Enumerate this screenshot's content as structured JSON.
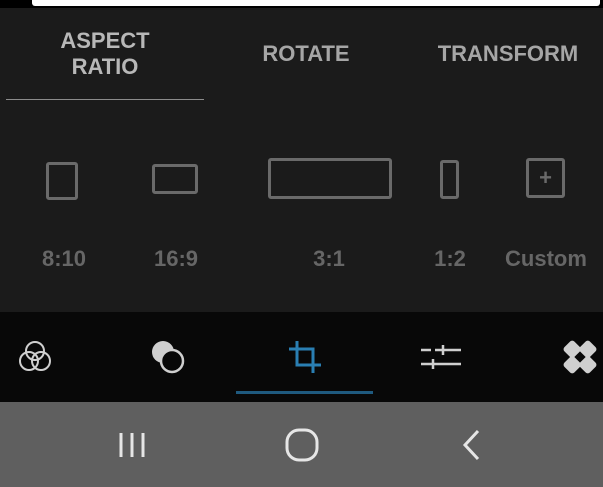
{
  "tabs": [
    {
      "label_line1": "ASPECT",
      "label_line2": "RATIO",
      "active": true
    },
    {
      "label": "ROTATE",
      "active": false
    },
    {
      "label": "TRANSFORM",
      "active": false
    }
  ],
  "ratios": [
    {
      "label": "8:10"
    },
    {
      "label": "16:9"
    },
    {
      "label": "3:1"
    },
    {
      "label": "1:2"
    },
    {
      "label": "Custom",
      "icon_glyph": "+"
    }
  ],
  "toolbar": {
    "items": [
      {
        "icon": "filters-icon"
      },
      {
        "icon": "overlay-icon"
      },
      {
        "icon": "crop-icon",
        "active": true
      },
      {
        "icon": "adjust-sliders-icon"
      },
      {
        "icon": "healing-bandage-icon"
      }
    ],
    "active_color": "#2a7fb3",
    "inactive_color": "#cfcfcf"
  },
  "navbar": {
    "items": [
      {
        "icon": "recent-apps-icon"
      },
      {
        "icon": "home-icon"
      },
      {
        "icon": "back-icon"
      }
    ]
  }
}
